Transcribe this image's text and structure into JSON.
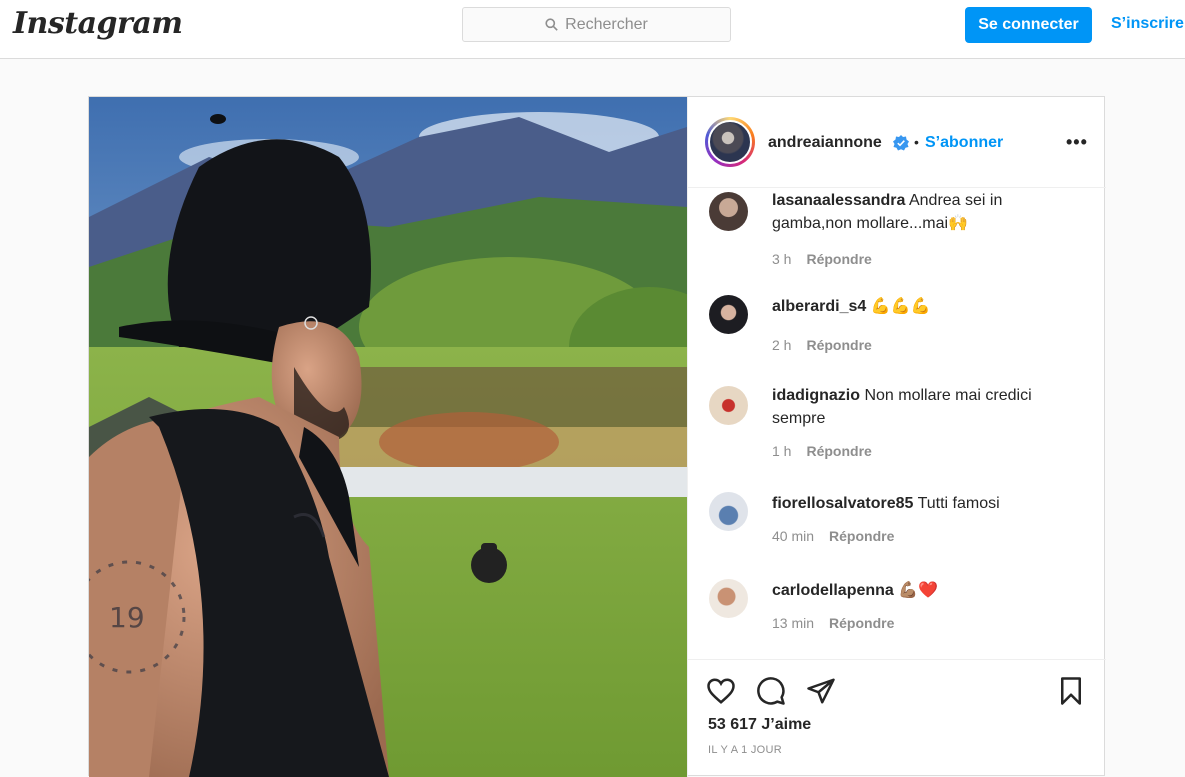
{
  "header": {
    "logo": "Instagram",
    "search_placeholder": "Rechercher",
    "login_label": "Se connecter",
    "signup_label": "S’inscrire"
  },
  "post": {
    "author": "andreaiannone",
    "separator": "•",
    "follow_label": "S’abonner",
    "more_label": "•••",
    "likes": "53 617 J’aime",
    "date": "IL Y A 1 JOUR"
  },
  "comments": [
    {
      "user": "lasanaalessandra",
      "text": "Andrea sei in gamba,non mollare...mai🙌",
      "time": "3 h",
      "reply": "Répondre"
    },
    {
      "user": "alberardi_s4",
      "text": "💪💪💪",
      "time": "2 h",
      "reply": "Répondre"
    },
    {
      "user": "idadignazio",
      "text": "Non mollare mai credici sempre",
      "time": "1 h",
      "reply": "Répondre"
    },
    {
      "user": "fiorellosalvatore85",
      "text": "Tutti famosi",
      "time": "40 min",
      "reply": "Répondre"
    },
    {
      "user": "carlodellapenna",
      "text": "💪🏽❤️",
      "time": "13 min",
      "reply": "Répondre"
    }
  ],
  "colors": {
    "accent": "#0095f6",
    "border": "#dbdbdb",
    "muted": "#8e8e8e"
  },
  "icons": [
    "search-icon",
    "verified-icon",
    "heart-icon",
    "comment-icon",
    "share-icon",
    "bookmark-icon"
  ]
}
